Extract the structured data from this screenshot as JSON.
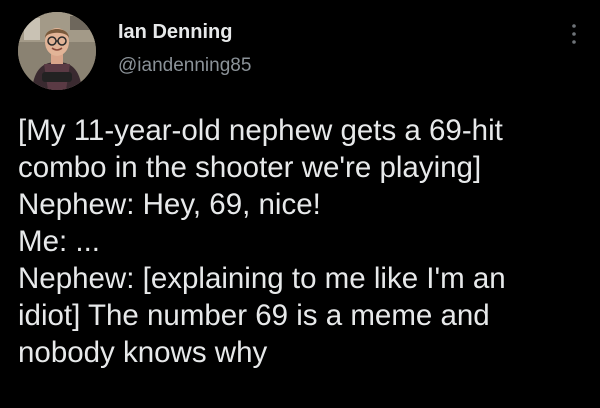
{
  "author": {
    "display_name": "Ian Denning",
    "handle": "@iandenning85",
    "avatar_icon": "profile-photo"
  },
  "menu": {
    "icon": "more-vertical-icon"
  },
  "tweet": {
    "lines": [
      "[My 11-year-old nephew gets a 69-hit",
      "combo in the shooter we're playing]",
      "Nephew: Hey, 69, nice!",
      "Me: ...",
      "Nephew: [explaining to me like I'm an",
      "idiot] The number 69 is a meme and",
      "nobody knows why"
    ]
  },
  "colors": {
    "background": "#000000",
    "text": "#e7e9ea",
    "secondary_text": "#8b9298"
  }
}
